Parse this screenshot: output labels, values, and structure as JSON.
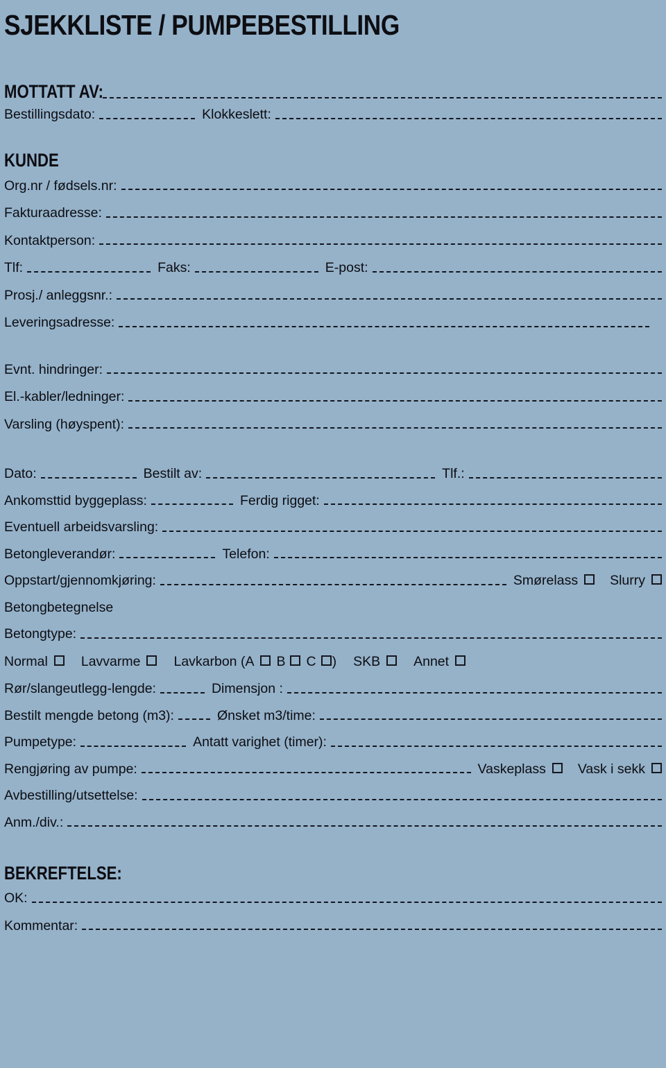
{
  "document": {
    "title": "SJEKKLISTE / PUMPEBESTILLING"
  },
  "sections": {
    "mottatt": {
      "heading": "MOTTATT AV:",
      "bestillingsdato_label": "Bestillingsdato:",
      "klokkeslett_label": "Klokkeslett:"
    },
    "kunde": {
      "heading": "KUNDE",
      "orgnr_label": "Org.nr / fødsels.nr:",
      "fakturaadresse_label": "Fakturaadresse:",
      "kontaktperson_label": "Kontaktperson:",
      "tlf_label": "Tlf:",
      "faks_label": "Faks:",
      "epost_label": "E-post:",
      "prosj_label": "Prosj./ anleggsnr.:",
      "leveringsadresse_label": "Leveringsadresse:"
    },
    "hindringer": {
      "evnt_label": "Evnt. hindringer:",
      "elkabler_label": "El.-kabler/ledninger:",
      "varsling_label": "Varsling (høyspent):"
    },
    "bestilling": {
      "dato_label": "Dato:",
      "bestilt_av_label": "Bestilt av:",
      "tlf_label": "Tlf.:",
      "ankomsttid_label": "Ankomsttid byggeplass:",
      "ferdig_rigget_label": "Ferdig rigget:",
      "arbeidsvarsling_label": "Eventuell arbeidsvarsling:",
      "betongleverandor_label": "Betongleverandør:",
      "telefon_label": "Telefon:",
      "oppstart_label": "Oppstart/gjennomkjøring:",
      "smorelass_label": "Smørelass",
      "slurry_label": "Slurry"
    },
    "betong": {
      "betegnelse_label": "Betongbetegnelse",
      "betongtype_label": "Betongtype:",
      "types": {
        "normal": "Normal",
        "lavvarme": "Lavvarme",
        "lavkarbon_open": "Lavkarbon (A",
        "lavkarbon_b": "B",
        "lavkarbon_c": "C",
        "lavkarbon_close": ")",
        "skb": "SKB",
        "annet": "Annet"
      },
      "ror_label": "Rør/slangeutlegg-lengde:",
      "dimensjon_label": "Dimensjon :",
      "bestilt_mengde_label": "Bestilt mengde betong (m3):",
      "onsket_label": "Ønsket m3/time:",
      "pumpetype_label": "Pumpetype:",
      "varighet_label": "Antatt varighet (timer):",
      "rengjoring_label": "Rengjøring av pumpe:",
      "vaskeplass_label": "Vaskeplass",
      "vask_i_sekk_label": "Vask i sekk",
      "avbestilling_label": "Avbestilling/utsettelse:",
      "anm_label": "Anm./div.:"
    },
    "bekreftelse": {
      "heading": "BEKREFTELSE:",
      "ok_label": "OK:",
      "kommentar_label": "Kommentar:"
    }
  },
  "colors": {
    "background": "#95b2c9",
    "ink": "#0d0d12"
  }
}
